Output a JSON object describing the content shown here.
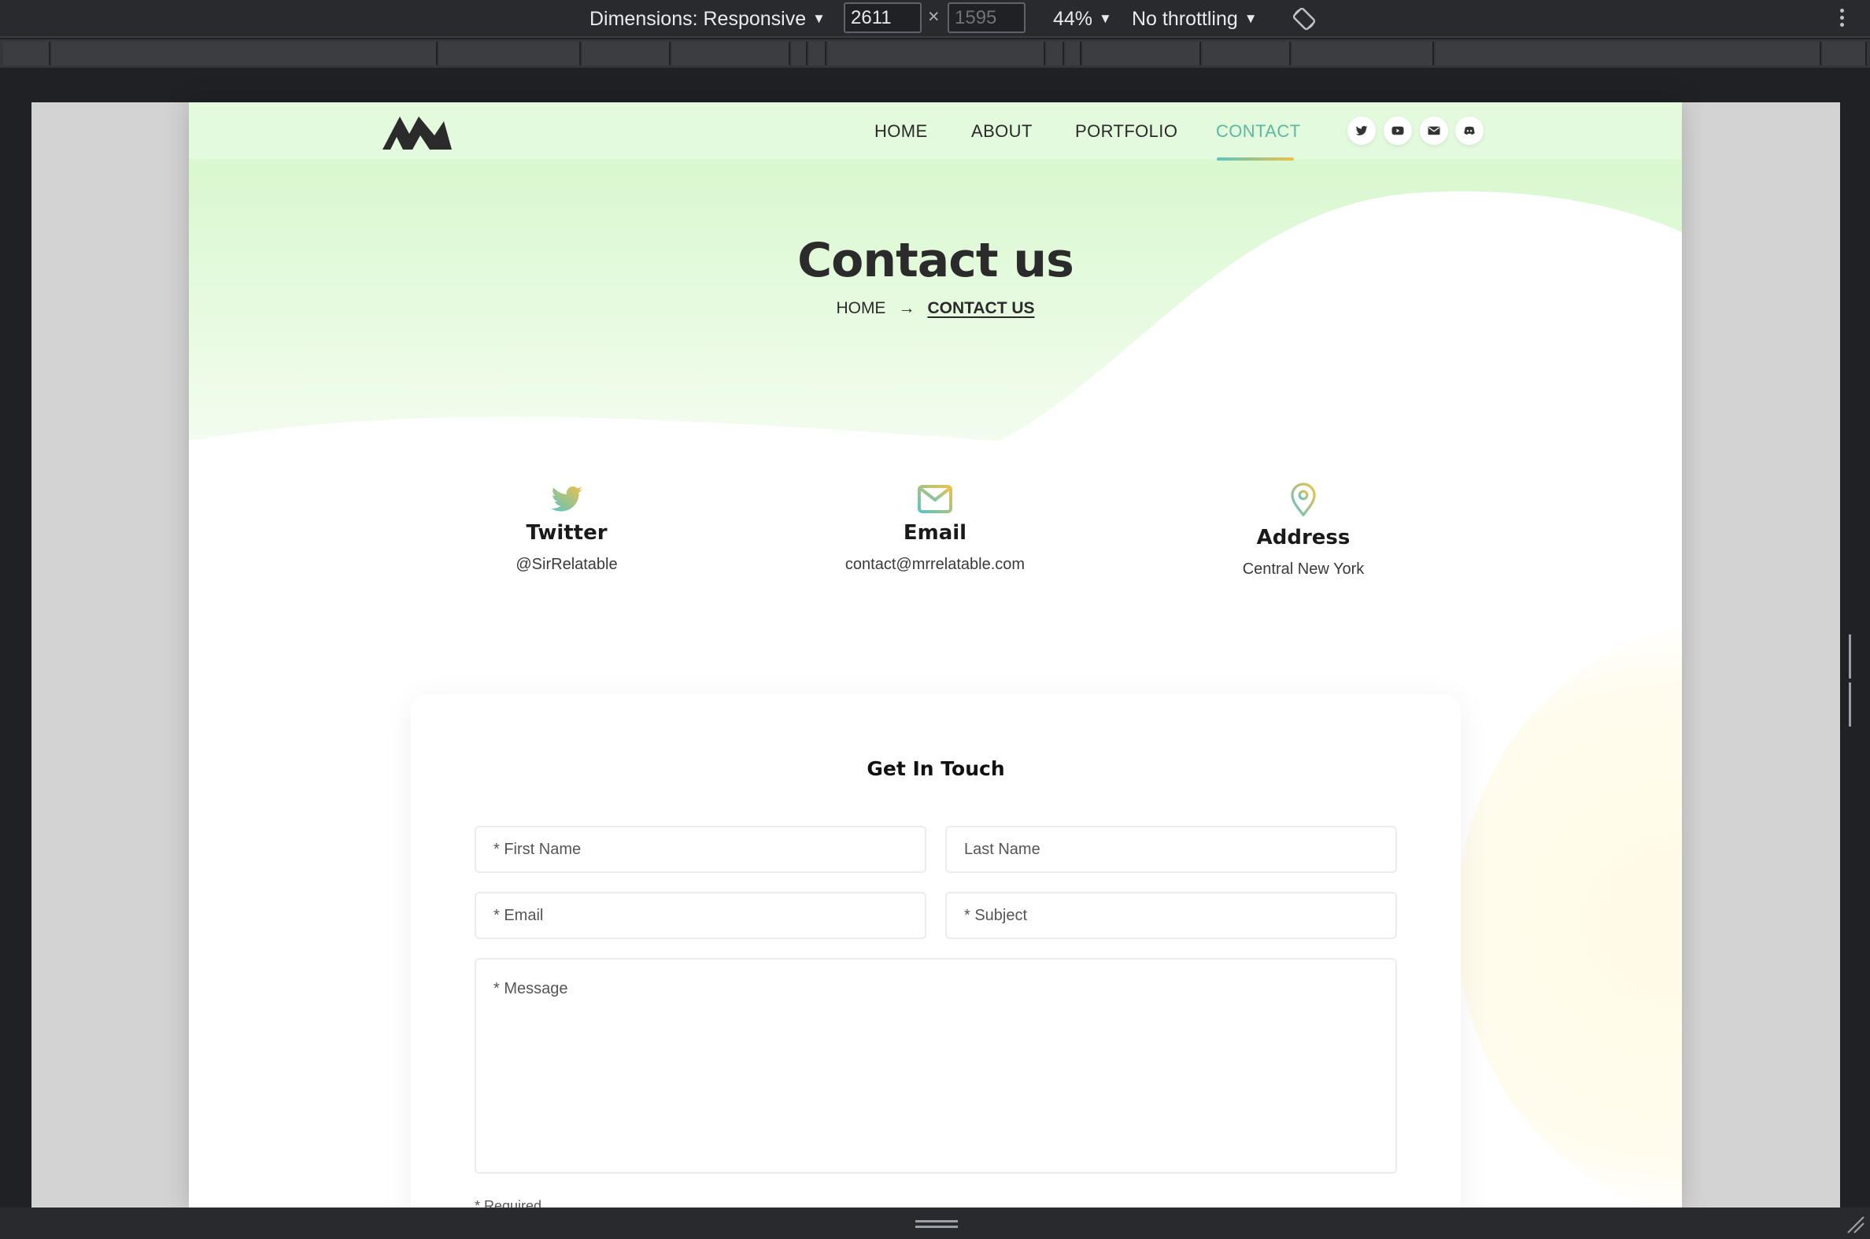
{
  "devtools": {
    "dimensions_label": "Dimensions: Responsive",
    "width_value": "2611",
    "height_value": "1595",
    "times_sign": "×",
    "zoom_label": "44%",
    "throttle_label": "No throttling",
    "caret": "▼"
  },
  "nav": {
    "links": [
      "HOME",
      "ABOUT",
      "PORTFOLIO",
      "CONTACT"
    ],
    "active_color": "#5bb8a3",
    "social_icons": [
      "twitter-icon",
      "youtube-icon",
      "mail-icon",
      "discord-icon"
    ]
  },
  "hero": {
    "title": "Contact us",
    "breadcrumb_home": "HOME",
    "breadcrumb_arrow": "→",
    "breadcrumb_current": "CONTACT US"
  },
  "info_cards": [
    {
      "icon": "twitter-bird-icon",
      "title": "Twitter",
      "value": "@SirRelatable"
    },
    {
      "icon": "envelope-icon",
      "title": "Email",
      "value": "contact@mrrelatable.com"
    },
    {
      "icon": "map-pin-icon",
      "title": "Address",
      "value": "Central New York"
    }
  ],
  "form": {
    "title": "Get In Touch",
    "first_name_placeholder": "* First Name",
    "last_name_placeholder": "Last Name",
    "email_placeholder": "* Email",
    "subject_placeholder": "* Subject",
    "message_placeholder": "* Message",
    "required_note": "* Required"
  },
  "colors": {
    "gradient_teal": "#5ec4c0",
    "gradient_gold": "#ecc14a",
    "hero_green": "#d9f7d2"
  }
}
